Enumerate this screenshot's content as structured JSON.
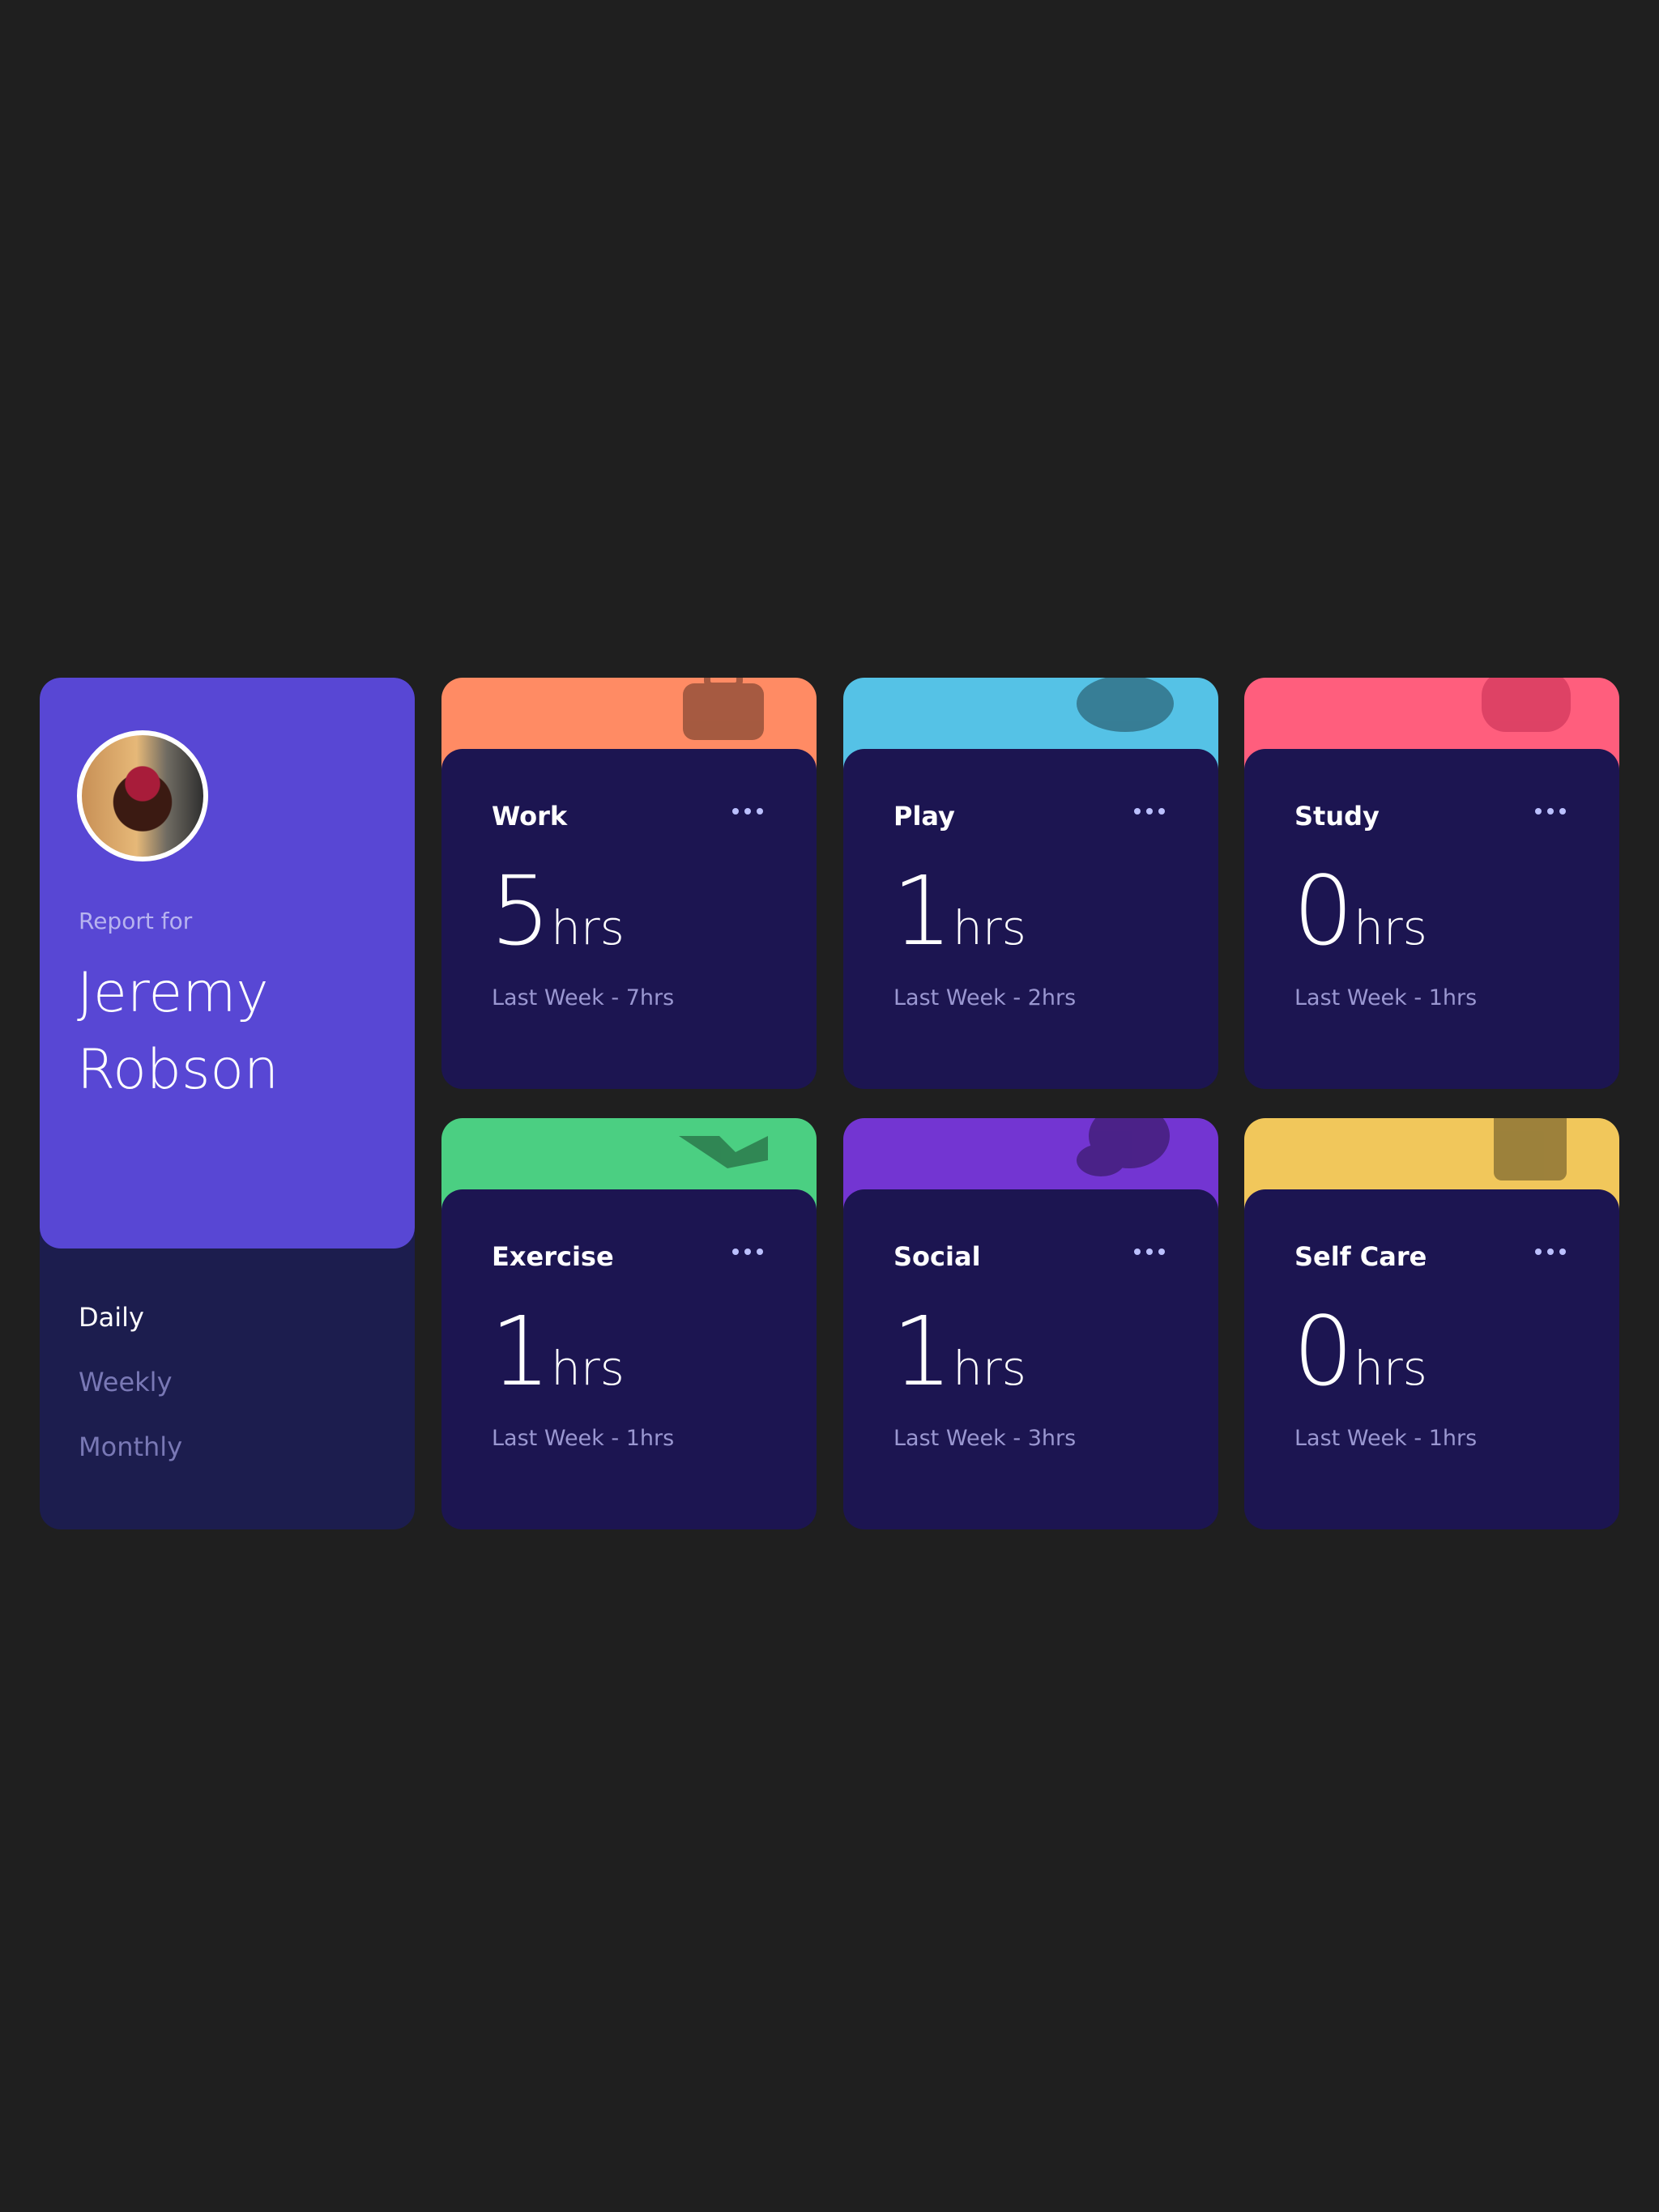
{
  "profile": {
    "report_label": "Report for",
    "name": "Jeremy Robson"
  },
  "periods": [
    {
      "label": "Daily",
      "active": true
    },
    {
      "label": "Weekly",
      "active": false
    },
    {
      "label": "Monthly",
      "active": false
    }
  ],
  "cards": [
    {
      "title": "Work",
      "current": "5",
      "unit": "hrs",
      "previous": "Last Week - 7hrs",
      "color": "#ff8b64",
      "icon": "briefcase-icon"
    },
    {
      "title": "Play",
      "current": "1",
      "unit": "hrs",
      "previous": "Last Week - 2hrs",
      "color": "#55c2e6",
      "icon": "game-controller-icon"
    },
    {
      "title": "Study",
      "current": "0",
      "unit": "hrs",
      "previous": "Last Week - 1hrs",
      "color": "#ff5e7d",
      "icon": "book-icon"
    },
    {
      "title": "Exercise",
      "current": "1",
      "unit": "hrs",
      "previous": "Last Week - 1hrs",
      "color": "#4bcf82",
      "icon": "runner-icon"
    },
    {
      "title": "Social",
      "current": "1",
      "unit": "hrs",
      "previous": "Last Week - 3hrs",
      "color": "#7335d2",
      "icon": "speech-bubble-icon"
    },
    {
      "title": "Self Care",
      "current": "0",
      "unit": "hrs",
      "previous": "Last Week - 1hrs",
      "color": "#f1c75b",
      "icon": "heart-box-icon"
    }
  ],
  "colors": {
    "page_bg": "#1f1f1f",
    "profile_bg": "#5847d4",
    "card_bg": "#1c1551",
    "muted_text": "#9a97d1"
  }
}
